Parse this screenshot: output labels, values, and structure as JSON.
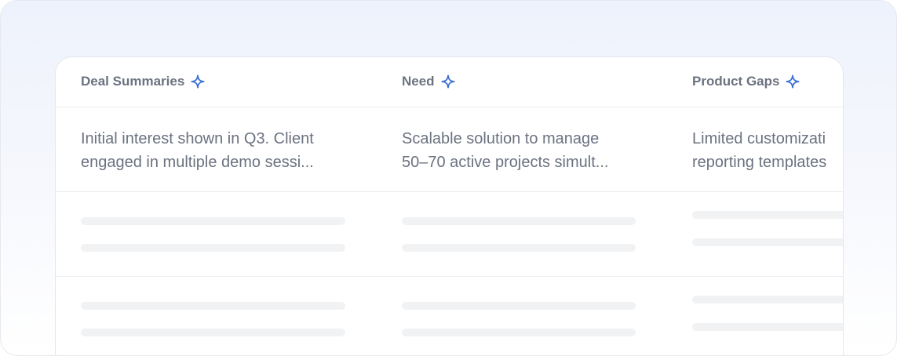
{
  "colors": {
    "accent": "#3b6fd6",
    "header_text": "#6b7280",
    "body_text": "#6b7280",
    "skeleton": "#f1f2f4"
  },
  "table": {
    "columns": [
      {
        "label": "Deal Summaries",
        "icon": "sparkle-icon"
      },
      {
        "label": "Need",
        "icon": "sparkle-icon"
      },
      {
        "label": "Product Gaps",
        "icon": "sparkle-icon"
      }
    ],
    "rows": [
      {
        "cells": [
          {
            "line1": "Initial interest shown in Q3. Client",
            "line2": "engaged in multiple demo sessi..."
          },
          {
            "line1": "Scalable solution to manage",
            "line2": "50–70 active projects simult..."
          },
          {
            "line1": "Limited customizati",
            "line2": "reporting templates"
          }
        ]
      }
    ]
  }
}
